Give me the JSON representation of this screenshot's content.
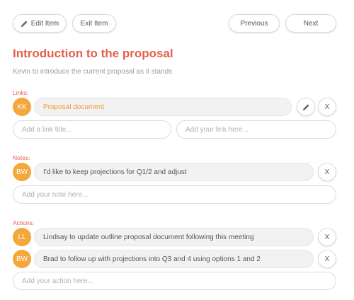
{
  "toolbar": {
    "edit_label": "Edit Item",
    "edit_icon": "pencil-icon",
    "exit_label": "Exit Item",
    "previous_label": "Previous",
    "next_label": "Next"
  },
  "item": {
    "title": "Introduction to the proposal",
    "description": "Kevin to introduce the current proposal as it stands"
  },
  "links": {
    "label": "Links:",
    "entries": [
      {
        "initials": "KK",
        "text": "Proposal document",
        "edit_icon": "pencil-icon",
        "remove_label": "X"
      }
    ],
    "title_placeholder": "Add a link title...",
    "url_placeholder": "Add your link here..."
  },
  "notes": {
    "label": "Notes:",
    "entries": [
      {
        "initials": "BW",
        "text": "I'd like to keep projections for Q1/2 and adjust",
        "remove_label": "X"
      }
    ],
    "placeholder": "Add your note here..."
  },
  "actions": {
    "label": "Actions:",
    "entries": [
      {
        "initials": "LL",
        "text": "Lindsay to update outline proposal document following this meeting",
        "remove_label": "X"
      },
      {
        "initials": "BW",
        "text": "Brad to follow up with projections into Q3 and 4 using options 1 and 2",
        "remove_label": "X"
      }
    ],
    "placeholder": "Add your action here..."
  },
  "colors": {
    "accent_red": "#e45e4d",
    "avatar_orange": "#f5a73c",
    "link_orange": "#f19a36"
  }
}
